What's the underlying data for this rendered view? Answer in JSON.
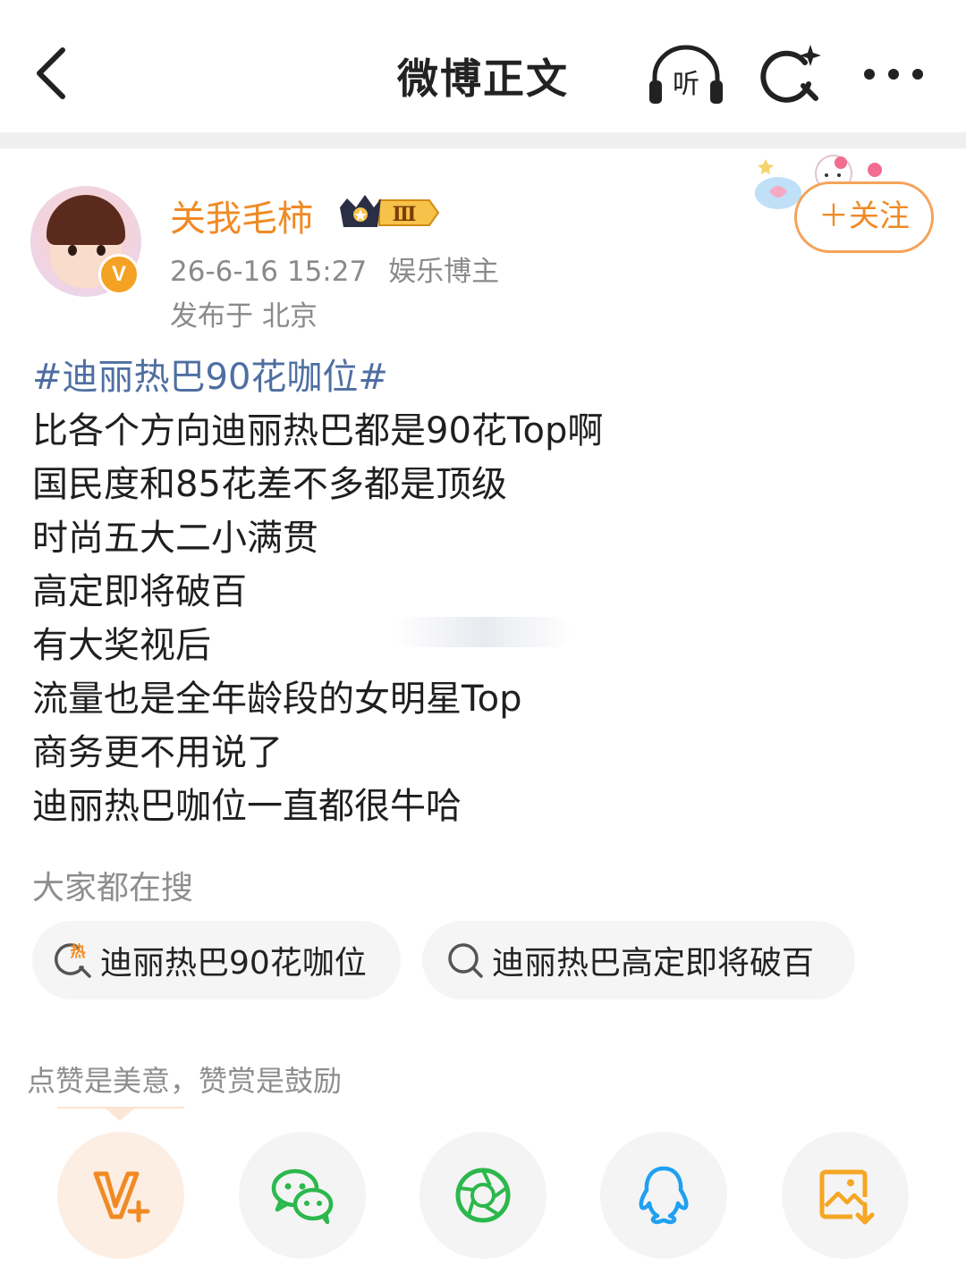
{
  "nav": {
    "title": "微博正文",
    "back_icon": "chevron-left-icon",
    "listen_label": "听",
    "search_icon": "search-sparkle-icon",
    "more_icon": "more-dots-icon"
  },
  "author": {
    "name": "关我毛柿",
    "rank_badge": "Ⅲ",
    "verify_mark": "V",
    "date": "26-6-16 15:27",
    "role": "娱乐博主",
    "location": "发布于 北京",
    "follow_label": "＋关注"
  },
  "post": {
    "hashtag": "#迪丽热巴90花咖位#",
    "lines": [
      "比各个方向迪丽热巴都是90花Top啊",
      "国民度和85花差不多都是顶级",
      "时尚五大二小满贯",
      "高定即将破百",
      "有大奖视后",
      "流量也是全年龄段的女明星Top",
      "商务更不用说了",
      "迪丽热巴咖位一直都很牛哈"
    ]
  },
  "search": {
    "heading": "大家都在搜",
    "chips": [
      {
        "label": "迪丽热巴90花咖位",
        "icon": "hot-search-icon",
        "hot_mark": "热"
      },
      {
        "label": "迪丽热巴高定即将破百",
        "icon": "search-icon"
      }
    ]
  },
  "reward": {
    "text": "点赞是美意，赞赏是鼓励"
  },
  "share": {
    "icons": [
      "vplus-reward-icon",
      "wechat-icon",
      "moments-icon",
      "qq-icon",
      "save-image-icon"
    ]
  },
  "colors": {
    "accent_orange": "#f08a25",
    "hashtag_blue": "#4f6fa2",
    "meta_gray": "#8a8a8a",
    "wechat_green": "#2bb84c",
    "qq_blue": "#1fa0f0",
    "save_orange": "#f5a623"
  }
}
